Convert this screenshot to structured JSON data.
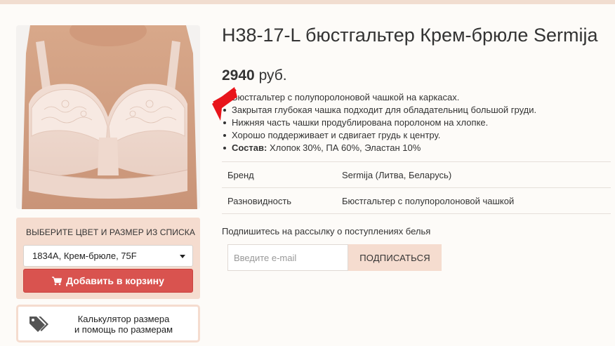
{
  "product": {
    "title": "H38-17-L бюстгальтер Крем-брюле Sermija",
    "price": "2940",
    "currency": "руб.",
    "image_alt": "product-photo",
    "features": [
      "Бюстгальтер с полупоролоновой чашкой на каркасах.",
      "Закрытая глубокая чашка подходит для обладательниц большой груди.",
      "Нижняя часть чашки продублирована поролоном на хлопке.",
      "Хорошо поддерживает и сдвигает грудь к центру."
    ],
    "composition_label": "Состав:",
    "composition_value": "Хлопок 30%, ПА 60%, Эластан 10%",
    "specs": [
      {
        "key": "Бренд",
        "value": "Sermija (Литва, Беларусь)"
      },
      {
        "key": "Разновидность",
        "value": "Бюстгальтер с полупоролоновой чашкой"
      }
    ]
  },
  "variant": {
    "title": "ВЫБЕРИТЕ ЦВЕТ И РАЗМЕР ИЗ СПИСКА",
    "selected": "1834A, Крем-брюле, 75F",
    "add_to_cart_label": "Добавить в корзину",
    "add_to_cart_icon": "cart-icon"
  },
  "size_calculator": {
    "line1": "Калькулятор размера",
    "line2": "и помощь по размерам",
    "icon": "tags-icon"
  },
  "newsletter": {
    "label": "Подпишитесь на рассылку о поступлениях белья",
    "placeholder": "Введите e-mail",
    "button_label": "ПОДПИСАТЬСЯ"
  },
  "colors": {
    "accent_pink": "#f5dccf",
    "cart_button": "#d9534f",
    "annotation_arrow": "#e8151b"
  }
}
